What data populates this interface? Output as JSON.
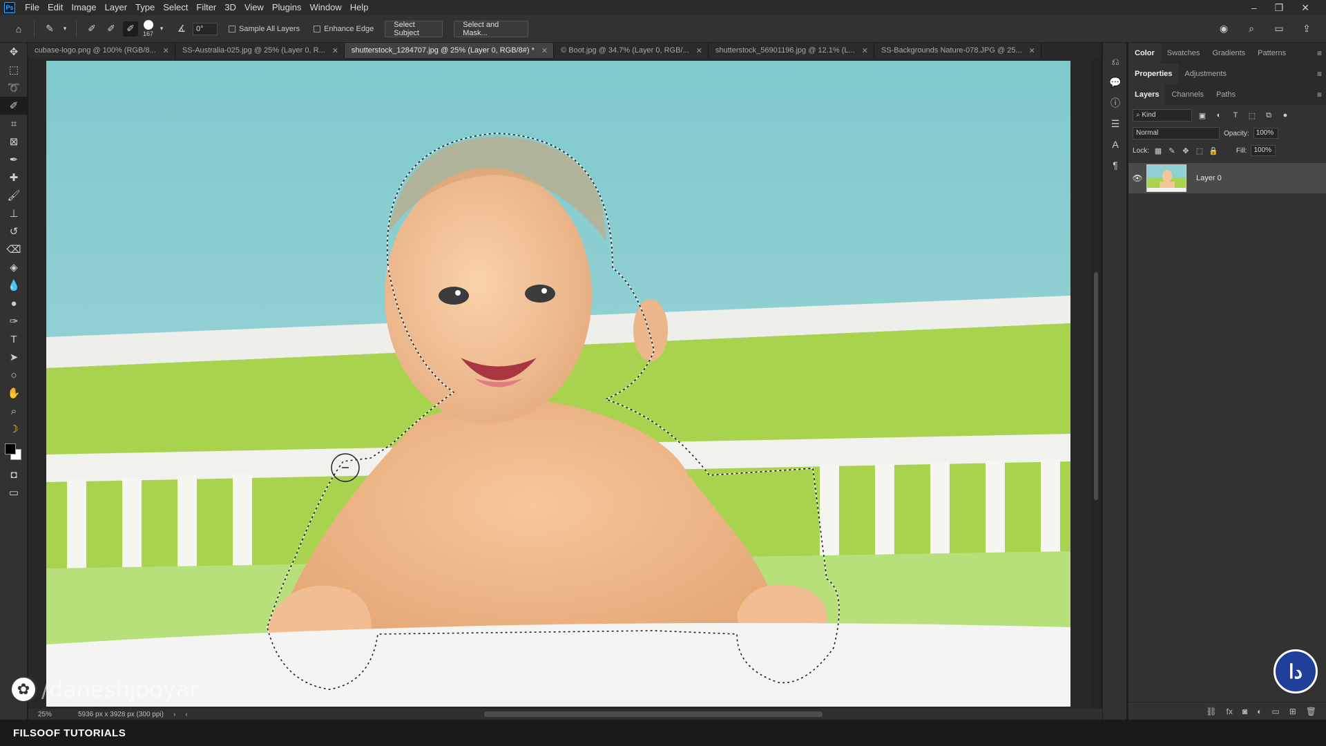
{
  "app": {
    "logo": "Ps"
  },
  "menu": [
    "File",
    "Edit",
    "Image",
    "Layer",
    "Type",
    "Select",
    "Filter",
    "3D",
    "View",
    "Plugins",
    "Window",
    "Help"
  ],
  "options": {
    "brush_size": "167",
    "angle": "0°",
    "sample_all_layers": "Sample All Layers",
    "enhance_edge": "Enhance Edge",
    "select_subject": "Select Subject",
    "select_and_mask": "Select and Mask..."
  },
  "tabs": [
    "cubase-logo.png @ 100% (RGB/8...",
    "SS-Australia-025.jpg @ 25% (Layer 0, R...",
    "shutterstock_1284707.jpg @ 25% (Layer 0, RGB/8#) *",
    "© Boot.jpg @ 34.7% (Layer 0, RGB/...",
    "shutterstock_56901196.jpg @ 12.1% (L...",
    "SS-Backgrounds Nature-078.JPG @ 25..."
  ],
  "status": {
    "zoom": "25%",
    "doc_size": "5936 px x 3928 px (300 ppi)"
  },
  "panels": {
    "color_tabs": [
      "Color",
      "Swatches",
      "Gradients",
      "Patterns"
    ],
    "props_tabs": [
      "Properties",
      "Adjustments"
    ],
    "layer_tabs": [
      "Layers",
      "Channels",
      "Paths"
    ],
    "kind": "Kind",
    "blend_mode": "Normal",
    "opacity_label": "Opacity:",
    "opacity": "100%",
    "lock_label": "Lock:",
    "fill_label": "Fill:",
    "fill": "100%",
    "layer_name": "Layer 0"
  },
  "watermark": {
    "handle": "/daneshjooyar"
  },
  "footer": {
    "title": "FILSOOF TUTORIALS"
  },
  "colors": {
    "accent": "#31a8ff",
    "sky": "#8fd0d2",
    "wall": "#a9d24f",
    "crib": "#f2f2f2"
  }
}
